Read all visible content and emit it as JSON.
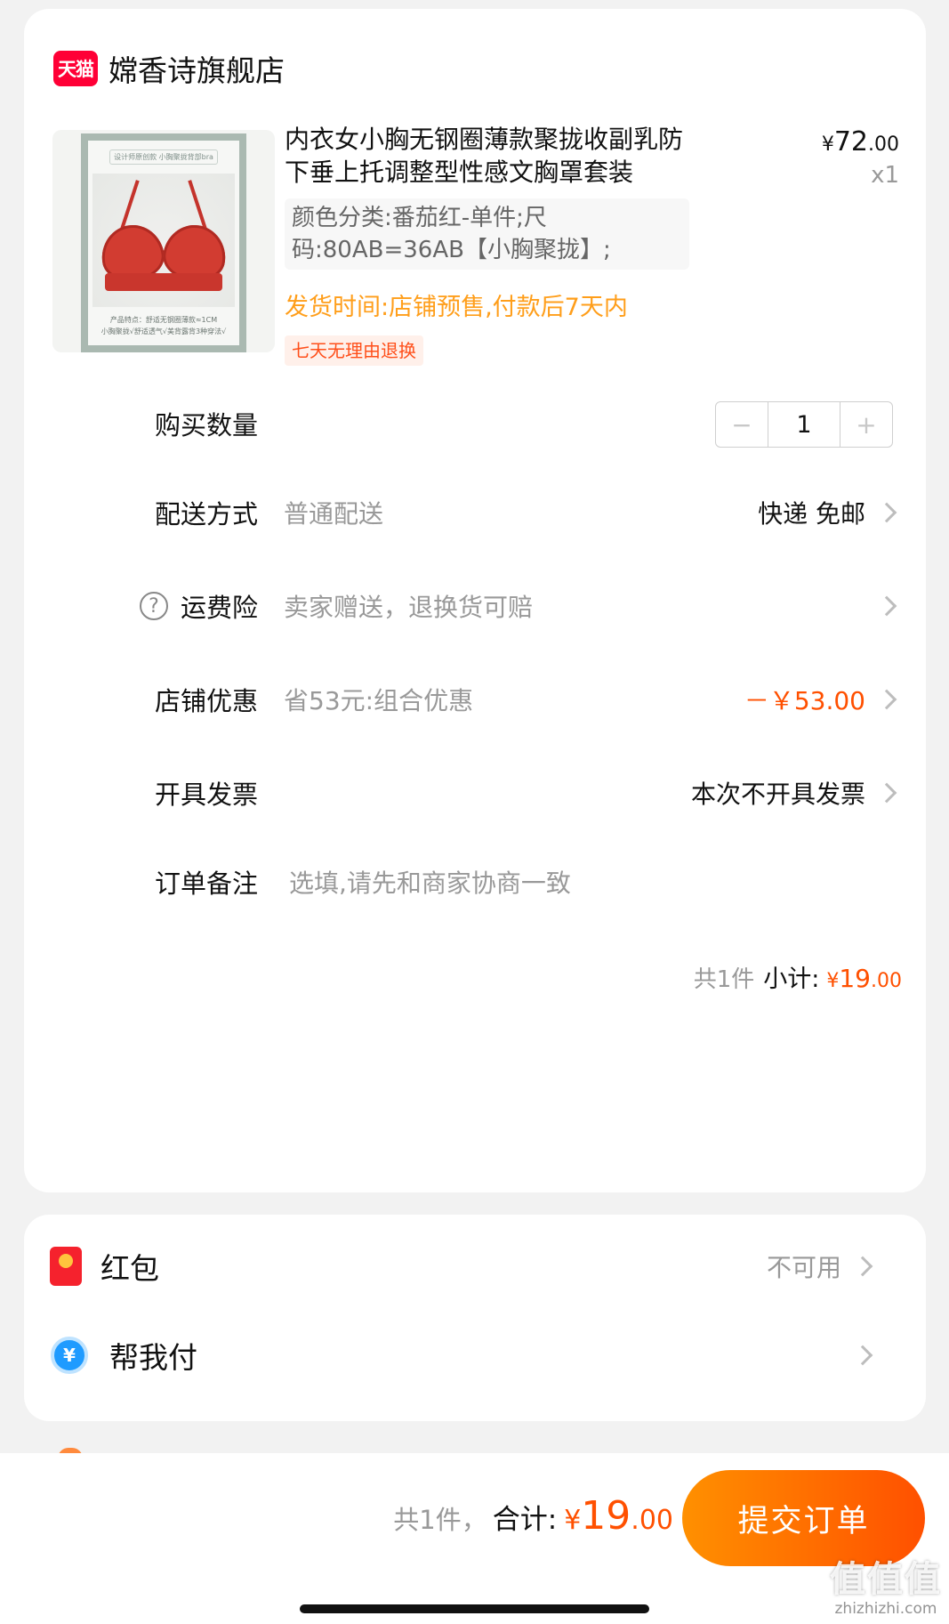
{
  "store": {
    "badge": "天猫",
    "name": "嫦香诗旗舰店"
  },
  "product": {
    "thumb_caption_top": "设计师原创款   小胸聚拢背部bra",
    "thumb_caption_bottom_1": "产品特点：舒适无钢圈薄款≈1CM",
    "thumb_caption_bottom_2": "小胸聚拢√舒适透气√美背露背3种穿法√",
    "title": "内衣女小胸无钢圈薄款聚拢收副乳防下垂上托调整型性感文胸罩套装",
    "price_currency": "¥",
    "price_int": "72",
    "price_dec": ".00",
    "quantity_mult": "x1",
    "sku": "颜色分类:番茄红-单件;尺码:80AB=36AB【小胸聚拢】;",
    "ship_time": "发货时间:店铺预售,付款后7天内",
    "return_badge": "七天无理由退换"
  },
  "rows": {
    "quantity": {
      "label": "购买数量",
      "minus": "−",
      "value": "1",
      "plus": "+"
    },
    "delivery": {
      "label": "配送方式",
      "value": "普通配送",
      "right": "快递 免邮"
    },
    "insurance": {
      "icon": "?",
      "label": "运费险",
      "value": "卖家赠送，退换货可赔"
    },
    "discount": {
      "label": "店铺优惠",
      "value": "省53元:组合优惠",
      "right": "－￥53.00"
    },
    "invoice": {
      "label": "开具发票",
      "right": "本次不开具发票"
    },
    "note": {
      "label": "订单备注",
      "placeholder": "选填,请先和商家协商一致"
    }
  },
  "subtotal": {
    "count": "共1件",
    "label": "小计:",
    "currency": "¥",
    "int": "19",
    "dec": ".00"
  },
  "extras": {
    "redpacket": {
      "label": "红包",
      "right": "不可用"
    },
    "helppay": {
      "icon": "¥",
      "label": "帮我付"
    }
  },
  "bottom": {
    "count": "共1件，",
    "label": "合计:",
    "currency": "¥",
    "int": "19",
    "dec": ".00",
    "submit": "提交订单"
  },
  "watermark": {
    "main": "值值值",
    "sub": "zhizhizhi.com"
  },
  "colors": {
    "accent": "#ff5000",
    "accent_gradient_start": "#ff9000",
    "ship_time": "#ff9e1a",
    "tmall": "#ff0036"
  }
}
